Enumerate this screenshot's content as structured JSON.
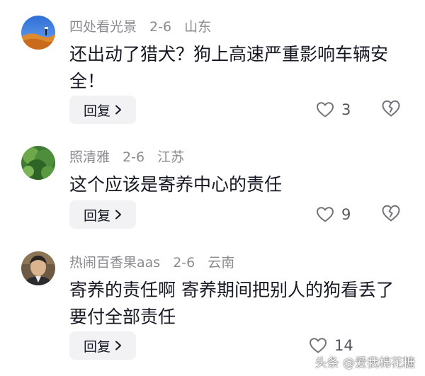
{
  "comments": [
    {
      "username": "四处看光景",
      "date": "2-6",
      "location": "山东",
      "text": "还出动了猎犬？狗上高速严重影响车辆安全！",
      "reply_label": "回复",
      "likes": "3"
    },
    {
      "username": "照清雅",
      "date": "2-6",
      "location": "江苏",
      "text": "这个应该是寄养中心的责任",
      "reply_label": "回复",
      "likes": "9"
    },
    {
      "username": "热闹百香果aas",
      "date": "2-6",
      "location": "云南",
      "text": "寄养的责任啊 寄养期间把别人的狗看丢了 要付全部责任",
      "reply_label": "回复",
      "likes": "14"
    }
  ],
  "icons": {
    "like": "heart-outline-icon",
    "dislike": "broken-heart-icon",
    "reply_arrow": "chevron-right-icon"
  },
  "watermark": "头条 @爱我棉花糖",
  "colors": {
    "text_primary": "#161823",
    "text_secondary": "#8a8b91",
    "reply_bg": "#f2f2f4"
  }
}
